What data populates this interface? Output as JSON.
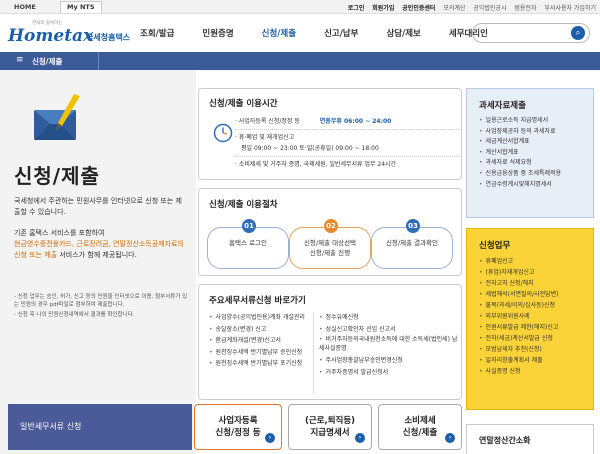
{
  "topbar": {
    "home": "HOME",
    "my_nts": "My NTS",
    "links": [
      "로그인",
      "회원가입",
      "공인인증센터",
      "모의계산",
      "공익법인공시",
      "범용전자",
      "부서사용자 가입하기"
    ]
  },
  "header": {
    "logo_small": "한국의 앞서가는",
    "logo_main": "Hometax",
    "logo_sub": "국세청홈택스",
    "menu": [
      "조회/발급",
      "민원증명",
      "신청/제출",
      "신고/납부",
      "상담/제보",
      "세무대리인"
    ],
    "active_menu": "신청/제출",
    "search_icon": "search-icon"
  },
  "subnav": {
    "menu_icon": "≡",
    "title": "신청/제출"
  },
  "left": {
    "title": "신청/제출",
    "desc1": "국세청에서 주관하는 민원사무를 인터넷으로 신청 또는 제출할 수 있습니다.",
    "desc2_a": "기존 홈택스 서비스를 포함하여",
    "desc2_hl": "현금영수증전용카드, 근로장려금, 연말정산소득공제자료의 신청 또는 제출",
    "desc2_b": "서비스가 함께 제공됩니다.",
    "note1": "- 신청 업무는 승인, 허가, 신고 등의 민원을 인터넷으로 이용, 첨부서류가 있는 민원의 경우 pdf파일로 첨부하여 제출합니다.",
    "note2": "- 신청 후 나의 민원신청내역에서 결과를 확인합니다.",
    "bottom_button": "일반세무서류 신청"
  },
  "hours": {
    "title": "신청/제출 이용시간",
    "row1_label": "· 사업자등록 신청/정정 등",
    "row1_value": "연중무휴 06:00 ~ 24:00",
    "row2_label": "· 휴·폐업 및 재개업신고",
    "row3_label": "평일 09:00 ~ 23:00 토·일(공휴일) 09:00 ~ 18:00",
    "row4_label": "· 소비제세 및 거주자 증명, 국제세원, 일반세무서류 업무 24시간"
  },
  "procedure": {
    "title": "신청/제출 이용절차",
    "steps": [
      {
        "num": "01",
        "line1": "홈택스 로그인",
        "line2": ""
      },
      {
        "num": "02",
        "line1": "신청/제출 대상선택",
        "line2": "신청/제출 진행"
      },
      {
        "num": "03",
        "line1": "신청/제출 결과확인",
        "line2": ""
      }
    ]
  },
  "shortcuts": {
    "title": "주요세무서류신청 바로가기",
    "left": [
      "사업양수(공익법인용)계좌 개설관리",
      "송달장소(변경) 신고",
      "환급계좌개설(변경)신고서",
      "원천징수세액 반기별납부 승인신청",
      "원천징수세액 반기별납부 포기신청"
    ],
    "right": [
      "정수유예신청",
      "성실신고확인자 선임 신고서",
      "비거주자등의국내원천소득에 대한 소득세(법인세) 납세사실증명",
      "주사업장총괄납부승인변경신청",
      "거주자증명서 발급신청서"
    ]
  },
  "bottom_buttons": [
    {
      "line1": "사업자등록",
      "line2": "신청/정정 등"
    },
    {
      "line1": "(근로,퇴직등)",
      "line2": "지급명세서"
    },
    {
      "line1": "소비제세",
      "line2": "신청/제출"
    }
  ],
  "materials": {
    "title": "과세자료제출",
    "items": [
      "일용근로소득 지급명세서",
      "사업장제공자 등의 과세자료",
      "세금계산서합계표",
      "계산서합계표",
      "과세자료 석제요청",
      "신용금융상품 중 조세특례적용",
      "연금수령계시및해지명세서"
    ]
  },
  "apply": {
    "title": "신청업무",
    "items": [
      "휴폐업신고",
      "(휴업)자재개업신고",
      "전자고지 신청/해지",
      "세법해석(서면질의/사전답변)",
      "불복(과세/이의/심사등)신청",
      "외부위원위원사례",
      "인원서류발급 제한(해지)신고",
      "전자(세금)계산서발급 신청",
      "모범납세자 추천(신청)",
      "일자리창출계획서 제출",
      "사실증명 신청"
    ]
  },
  "yearend": {
    "title": "연말정산간소화"
  }
}
